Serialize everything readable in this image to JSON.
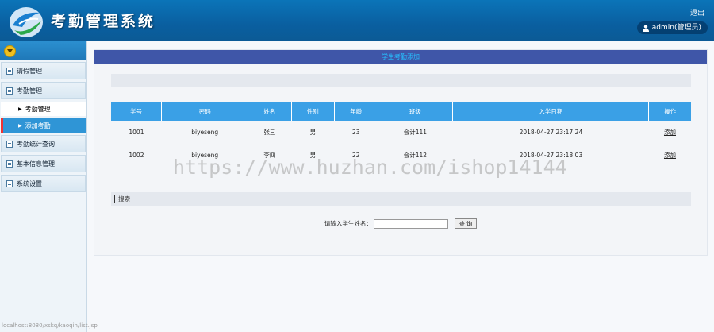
{
  "header": {
    "title": "考勤管理系统",
    "logout": "退出",
    "user": "admin(管理员)"
  },
  "sidebar": {
    "items": [
      {
        "label": "请假管理",
        "type": "menu"
      },
      {
        "label": "考勤管理",
        "type": "menu"
      },
      {
        "label": "考勤管理",
        "type": "sub"
      },
      {
        "label": "添加考勤",
        "type": "sub",
        "active": true
      },
      {
        "label": "考勤统计查询",
        "type": "menu"
      },
      {
        "label": "基本信息管理",
        "type": "menu"
      },
      {
        "label": "系统设置",
        "type": "menu"
      }
    ]
  },
  "main": {
    "title": "学生考勤添加",
    "table": {
      "headers": [
        "学号",
        "密码",
        "姓名",
        "性别",
        "年龄",
        "班级",
        "入学日期",
        "操作"
      ],
      "rows": [
        [
          "1001",
          "biyeseng",
          "张三",
          "男",
          "23",
          "会计111",
          "2018-04-27 23:17:24",
          "添加"
        ],
        [
          "1002",
          "biyeseng",
          "李四",
          "男",
          "22",
          "会计112",
          "2018-04-27 23:18:03",
          "添加"
        ]
      ]
    },
    "search_section": "搜索",
    "search_label": "请输入学生姓名：",
    "search_value": "",
    "search_button": "查 询"
  },
  "watermark": "https://www.huzhan.com/ishop14144",
  "status_url": "localhost:8080/xskq/kaoqin/list.jsp",
  "colors": {
    "header": "#0a62a5",
    "title_bar": "#3f56a8",
    "table_header": "#3aa0e6",
    "active_item": "#2f95d6"
  }
}
